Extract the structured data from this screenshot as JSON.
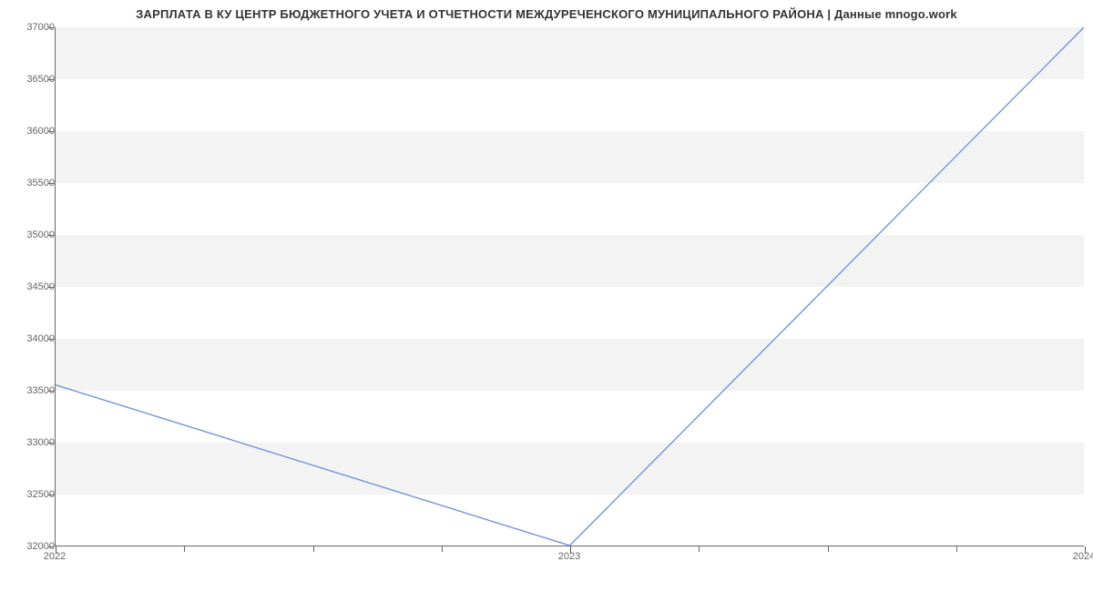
{
  "chart_data": {
    "type": "line",
    "title": "ЗАРПЛАТА В КУ ЦЕНТР БЮДЖЕТНОГО УЧЕТА И ОТЧЕТНОСТИ МЕЖДУРЕЧЕНСКОГО МУНИЦИПАЛЬНОГО РАЙОНА | Данные mnogo.work",
    "xlabel": "",
    "ylabel": "",
    "x": [
      2022,
      2023,
      2024
    ],
    "values": [
      33550,
      32000,
      37000
    ],
    "ylim": [
      32000,
      37000
    ],
    "y_ticks": [
      32000,
      32500,
      33000,
      33500,
      34000,
      34500,
      35000,
      35500,
      36000,
      36500,
      37000
    ],
    "x_ticks_major": [
      2022,
      2023,
      2024
    ],
    "x_minor_per_interval": 3,
    "line_color": "#6a8fd8",
    "band_color": "#f3f3f3"
  }
}
